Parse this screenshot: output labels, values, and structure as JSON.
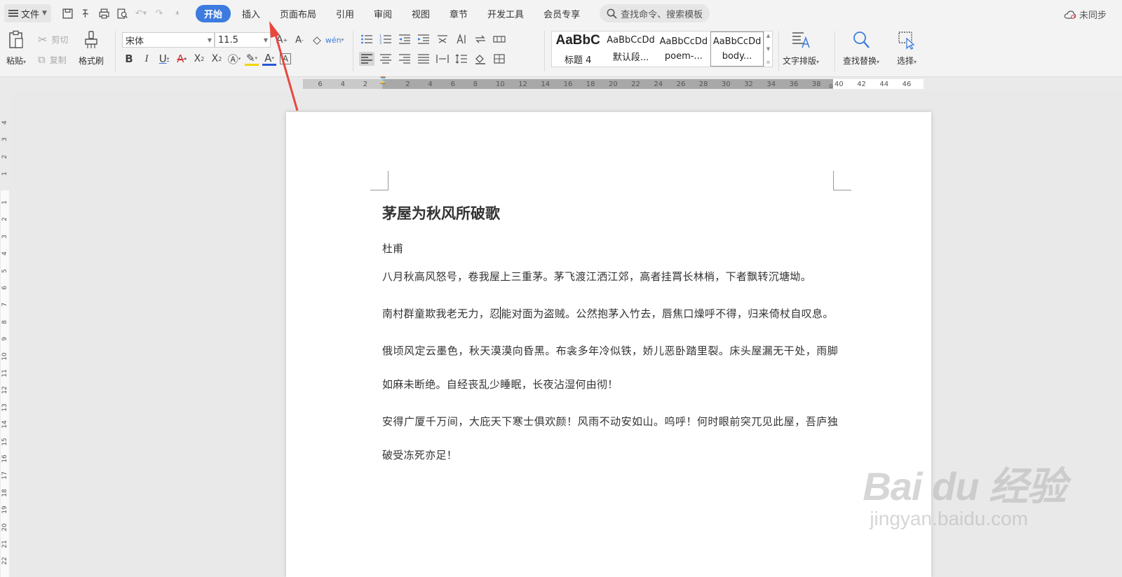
{
  "menubar": {
    "file_label": "文件",
    "tabs": [
      {
        "label": "开始",
        "active": true
      },
      {
        "label": "插入",
        "active": false
      },
      {
        "label": "页面布局",
        "active": false
      },
      {
        "label": "引用",
        "active": false
      },
      {
        "label": "审阅",
        "active": false
      },
      {
        "label": "视图",
        "active": false
      },
      {
        "label": "章节",
        "active": false
      },
      {
        "label": "开发工具",
        "active": false
      },
      {
        "label": "会员专享",
        "active": false
      }
    ],
    "search_placeholder": "查找命令、搜索模板",
    "sync_label": "未同步"
  },
  "ribbon": {
    "paste_label": "粘贴",
    "cut_label": "剪切",
    "copy_label": "复制",
    "format_painter_label": "格式刷",
    "font_name": "宋体",
    "font_size": "11.5",
    "styles": [
      {
        "preview": "AaBbC",
        "name": "标题 4"
      },
      {
        "preview": "AaBbCcDd",
        "name": "默认段..."
      },
      {
        "preview": "AaBbCcDd",
        "name": "poem-..."
      },
      {
        "preview": "AaBbCcDd",
        "name": "body..."
      }
    ],
    "text_layout_label": "文字排版",
    "find_replace_label": "查找替换",
    "select_label": "选择"
  },
  "ruler": {
    "h_ticks_left": [
      "6",
      "4",
      "2"
    ],
    "h_ticks": [
      "2",
      "4",
      "6",
      "8",
      "10",
      "12",
      "14",
      "16",
      "18",
      "20",
      "22",
      "24",
      "26",
      "28",
      "30",
      "32",
      "34",
      "36",
      "38",
      "40",
      "42",
      "44",
      "46"
    ],
    "v_ticks_top": [
      "4",
      "3",
      "2",
      "1"
    ],
    "v_ticks": [
      "1",
      "2",
      "3",
      "4",
      "5",
      "6",
      "7",
      "8",
      "9",
      "10",
      "11",
      "12",
      "13",
      "14",
      "15",
      "16",
      "17",
      "18",
      "19",
      "20",
      "21",
      "22"
    ]
  },
  "document": {
    "title": "茅屋为秋风所破歌",
    "author": "杜甫",
    "paragraphs": [
      "八月秋高风怒号，卷我屋上三重茅。茅飞渡江洒江郊，高者挂罥长林梢，下者飘转沉塘坳。",
      "南村群童欺我老无力，忍能对面为盗贼。公然抱茅入竹去，唇焦口燥呼不得，归来倚杖自叹息。",
      "俄顷风定云墨色，秋天漠漠向昏黑。布衾多年冷似铁，娇儿恶卧踏里裂。床头屋漏无干处，雨脚如麻未断绝。自经丧乱少睡眠，长夜沾湿何由彻！",
      "安得广厦千万间，大庇天下寒士俱欢颜！风雨不动安如山。呜呼！何时眼前突兀见此屋，吾庐独破受冻死亦足！"
    ],
    "para2_before_caret": "南村群童欺我老无力，忍",
    "para2_after_caret": "能对面为盗贼。公然抱茅入竹去，唇焦口燥呼不得，归来倚杖自叹息。"
  },
  "watermark": {
    "brand": "Bai du 经验",
    "url": "jingyan.baidu.com"
  },
  "colors": {
    "accent": "#3d7bdf",
    "arrow": "#e8473f"
  }
}
